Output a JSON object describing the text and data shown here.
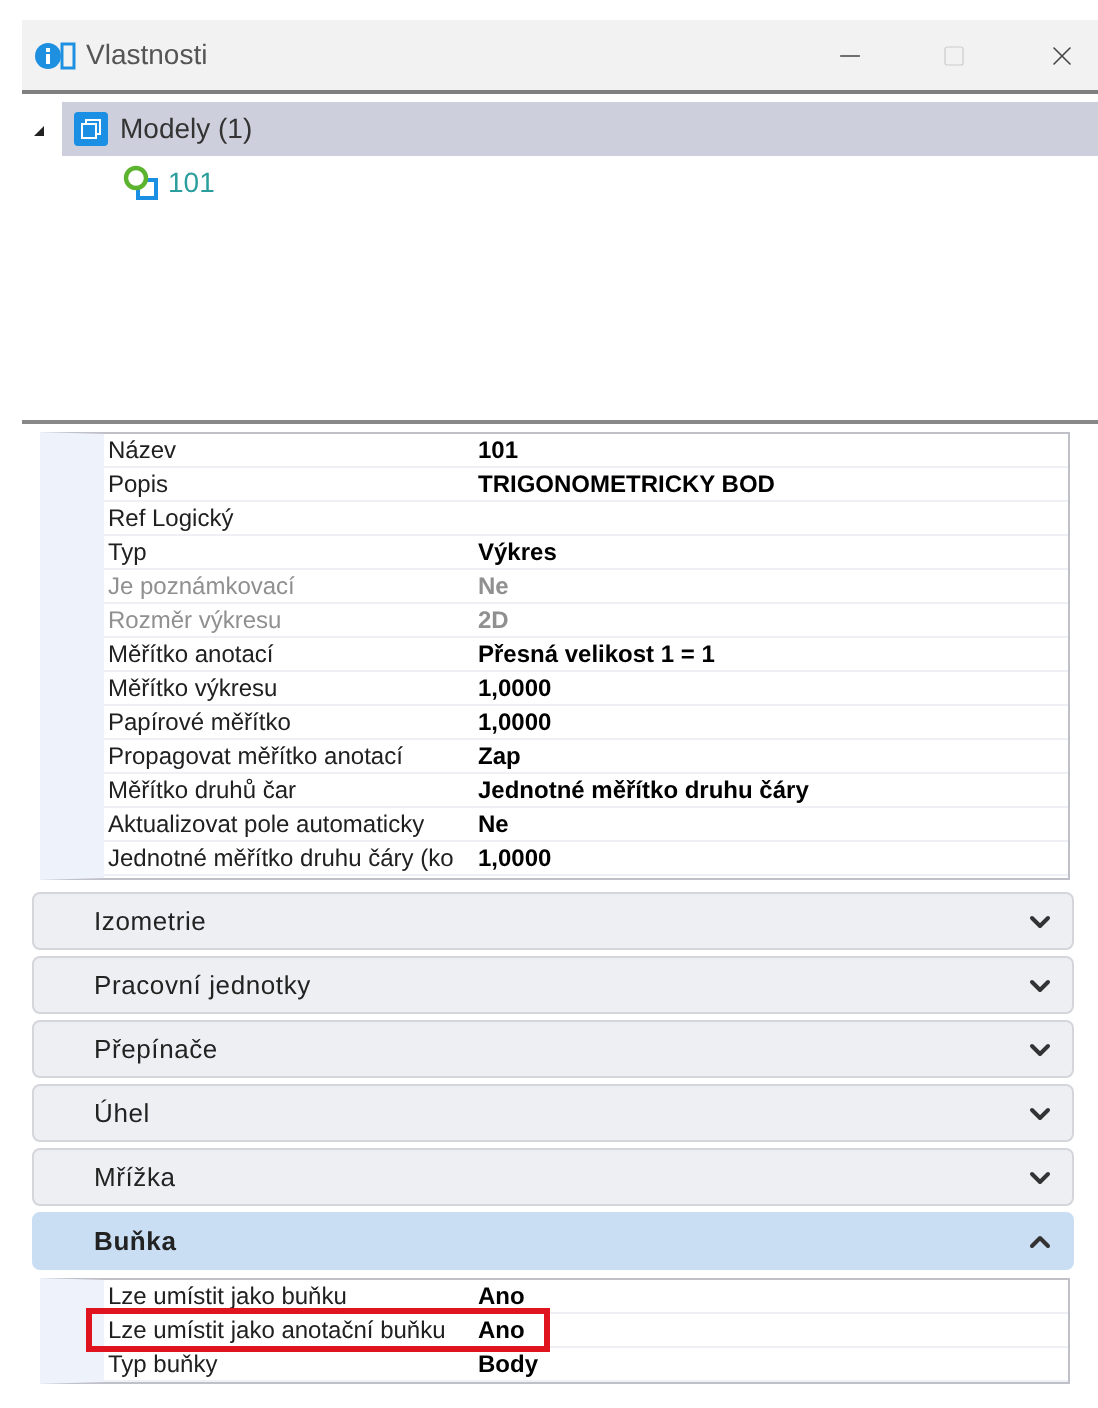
{
  "window": {
    "title": "Vlastnosti"
  },
  "tree": [
    {
      "label": "Modely (1)",
      "expanded": true,
      "selected": true,
      "children": [
        {
          "label": "101",
          "selected": false
        }
      ]
    }
  ],
  "properties": [
    {
      "name": "Název",
      "value": "101",
      "disabled": false
    },
    {
      "name": "Popis",
      "value": "TRIGONOMETRICKY BOD",
      "disabled": false
    },
    {
      "name": "Ref Logický",
      "disabled": false
    },
    {
      "name": "Typ",
      "value": "Výkres",
      "disabled": false
    },
    {
      "name": "Je poznámkovací",
      "value": "Ne",
      "disabled": true
    },
    {
      "name": "Rozměr výkresu",
      "value": "2D",
      "disabled": true
    },
    {
      "name": "Měřítko anotací",
      "value": "Přesná velikost 1 = 1",
      "disabled": false
    },
    {
      "name": "Měřítko výkresu",
      "value": "1,0000",
      "disabled": false
    },
    {
      "name": "Papírové měřítko",
      "value": "1,0000",
      "disabled": false
    },
    {
      "name": "Propagovat měřítko anotací",
      "value": "Zap",
      "disabled": false
    },
    {
      "name": "Měřítko druhů čar",
      "value": "Jednotné měřítko druhu čáry",
      "disabled": false
    },
    {
      "name": "Aktualizovat pole automaticky",
      "value": "Ne",
      "disabled": false
    },
    {
      "name": "Jednotné měřítko druhu čáry (ko",
      "value": "1,0000",
      "disabled": false
    }
  ],
  "sections": [
    {
      "title": "Izometrie",
      "expanded": false
    },
    {
      "title": "Pracovní jednotky",
      "expanded": false
    },
    {
      "title": "Přepínače",
      "expanded": false
    },
    {
      "title": "Úhel",
      "expanded": false
    },
    {
      "title": "Mřížka",
      "expanded": false
    },
    {
      "title": "Buňka",
      "expanded": true,
      "rows": [
        {
          "name": "Lze umístit jako buňku",
          "value": "Ano",
          "highlighted": false
        },
        {
          "name": "Lze umístit jako anotační buňku",
          "value": "Ano",
          "highlighted": true
        },
        {
          "name": "Typ buňky",
          "value": "Body",
          "highlighted": false
        }
      ]
    }
  ]
}
